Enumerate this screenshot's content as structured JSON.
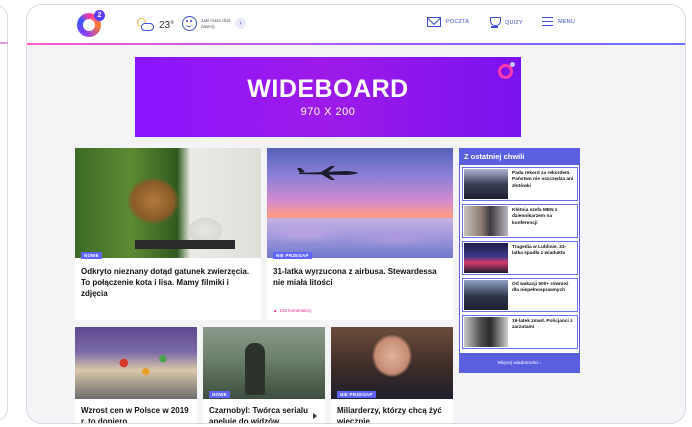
{
  "header": {
    "logo_sup": "2",
    "temperature": "23°",
    "mood_text": "Jaki masz dziś nastrój",
    "nav": {
      "mail": "POCZTA",
      "quiz": "QUIZY",
      "menu": "MENU"
    }
  },
  "ad": {
    "title": "WIDEBOARD",
    "size": "970 X 200"
  },
  "articles": [
    {
      "badge": "NOWE",
      "title": "Odkryto nieznany dotąd gatunek zwierzęcia. To połączenie kota i lisa. Mamy filmiki i zdjęcia"
    },
    {
      "badge": "NIE PRZEGAP",
      "title": "31-latka wyrzucona z airbusa. Stewardessa nie miała litości",
      "comments": "136 komentarzy"
    },
    {
      "badge": "",
      "title": "Wzrost cen w Polsce w 2019 r. to dopiero"
    },
    {
      "badge": "NOWE",
      "title": "Czarnobyl: Twórca serialu apeluje do widzów"
    },
    {
      "badge": "NIE PRZEGAP",
      "title": "Miliarderzy, którzy chcą żyć wiecznie"
    }
  ],
  "sidebar": {
    "title": "Z ostatniej chwili",
    "items": [
      {
        "title": "Pada rekord za rekordem. Państwo nie oszczędza ani złotówki"
      },
      {
        "title": "Kłótnia szefa MEN z dziennikarzem na konferencji"
      },
      {
        "title": "Tragedia w Lublinie. 33-latka spadła z wiaduktu"
      },
      {
        "title": "Od wakacji 500+ również dla niepełnosprawnych"
      },
      {
        "title": "19-latek zmarł. Policjanci z zarzutami"
      }
    ],
    "more": "Więcej wiadomości ›"
  },
  "colors": {
    "accent": "#5a5fe0",
    "ad_bg": "#8b14ff",
    "badge": "#5f63ff",
    "comments": "#e0278f"
  },
  "icons": [
    "weather-icon",
    "smiley-icon",
    "mail-icon",
    "trophy-icon",
    "menu-icon",
    "play-icon"
  ]
}
